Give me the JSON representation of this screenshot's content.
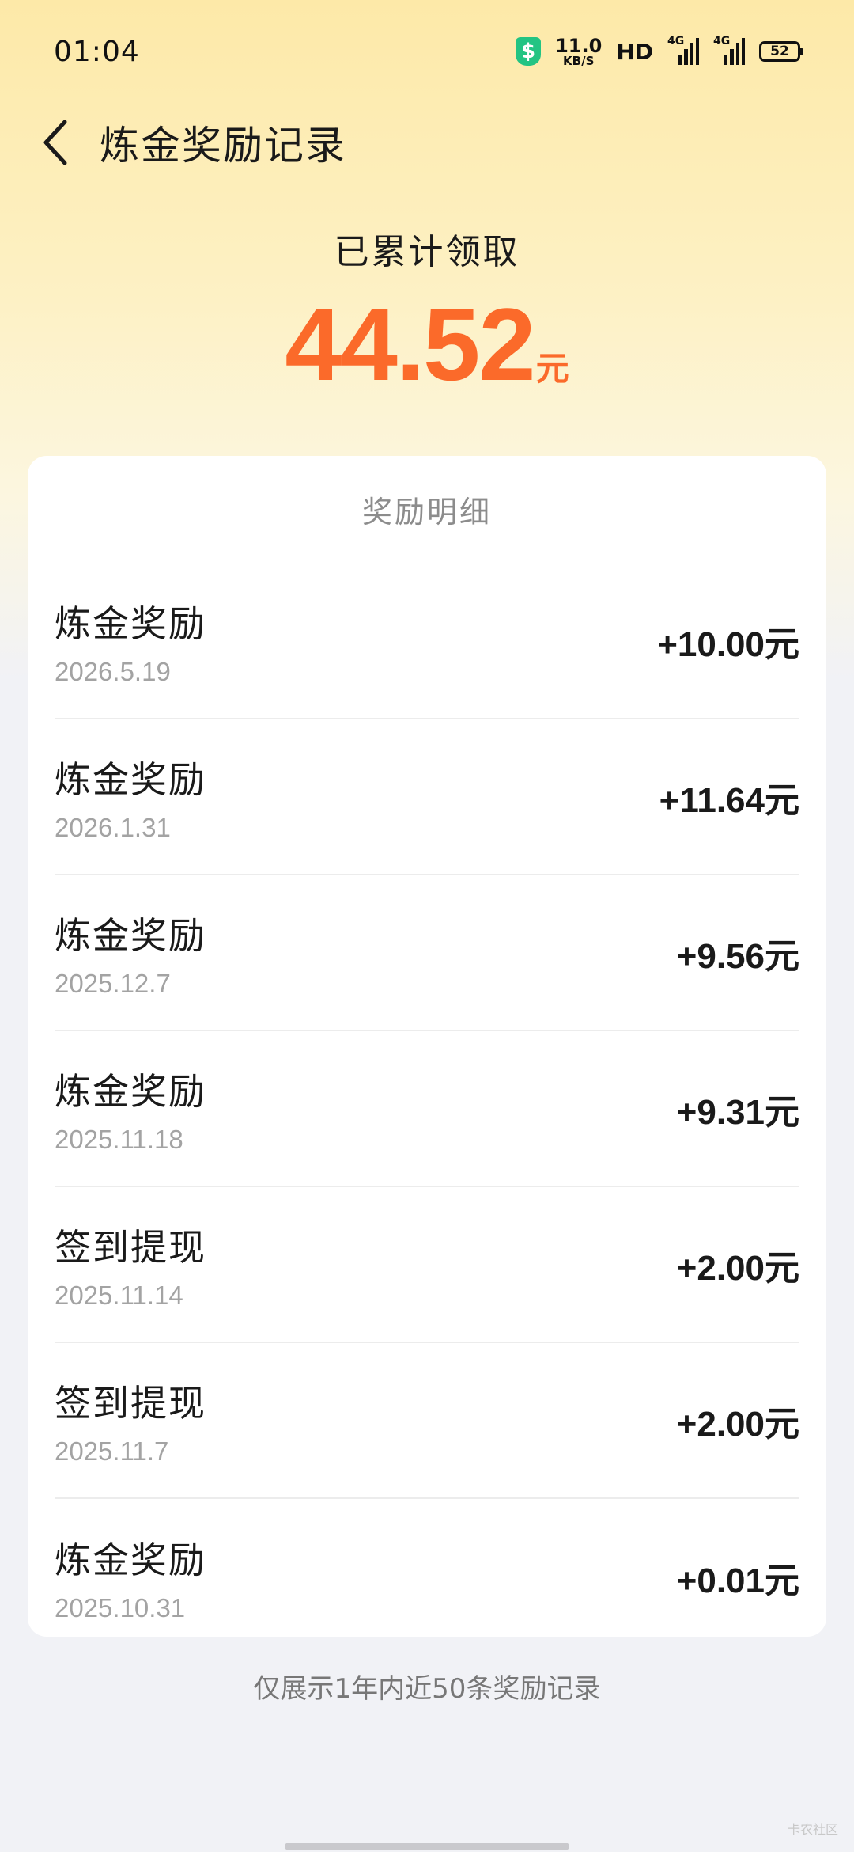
{
  "status_bar": {
    "time": "01:04",
    "net_speed_value": "11.0",
    "net_speed_unit": "KB/S",
    "hd_label": "HD",
    "signal1_label": "4G",
    "signal2_label": "4G",
    "battery": "52",
    "shield_icon": "shield-dollar-icon"
  },
  "header": {
    "back_icon": "chevron-left-icon",
    "title": "炼金奖励记录"
  },
  "summary": {
    "label": "已累计领取",
    "amount": "44.52",
    "unit": "元",
    "accent_color": "#fb6a2a"
  },
  "card": {
    "title": "奖励明细",
    "records": [
      {
        "name": "炼金奖励",
        "date": "2026.5.19",
        "amount": "+10.00元"
      },
      {
        "name": "炼金奖励",
        "date": "2026.1.31",
        "amount": "+11.64元"
      },
      {
        "name": "炼金奖励",
        "date": "2025.12.7",
        "amount": "+9.56元"
      },
      {
        "name": "炼金奖励",
        "date": "2025.11.18",
        "amount": "+9.31元"
      },
      {
        "name": "签到提现",
        "date": "2025.11.14",
        "amount": "+2.00元"
      },
      {
        "name": "签到提现",
        "date": "2025.11.7",
        "amount": "+2.00元"
      },
      {
        "name": "炼金奖励",
        "date": "2025.10.31",
        "amount": "+0.01元"
      }
    ]
  },
  "footnote": "仅展示1年内近50条奖励记录",
  "watermark": "卡农社区"
}
